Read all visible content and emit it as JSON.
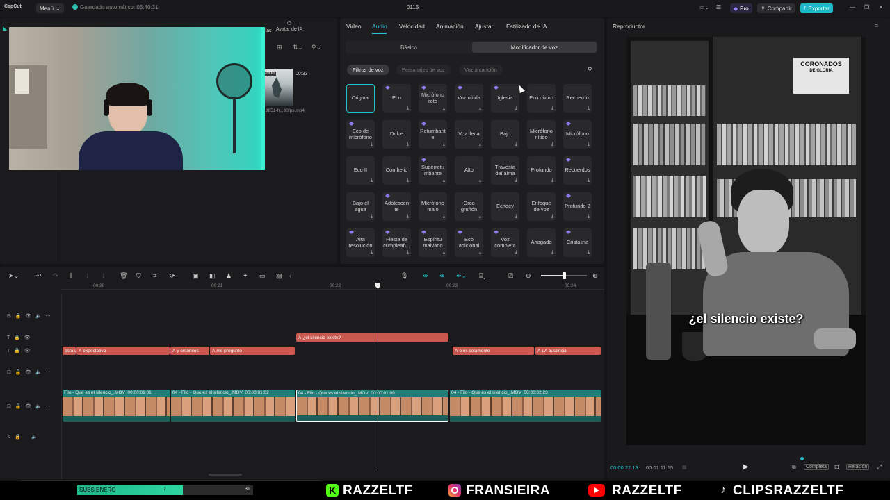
{
  "titlebar": {
    "app_name": "CapCut",
    "menu_label": "Menú",
    "autosave": "Guardado automático: 05:40:31",
    "project_name": "0115",
    "pro_label": "Pro",
    "share_label": "Compartir",
    "export_label": "Exportar"
  },
  "media": {
    "tabs": [
      "llas",
      "Avatar de IA"
    ],
    "clip_duration": "00:33",
    "clip_name": "8851-h...30fps.mp4",
    "added_badge": "adido"
  },
  "audio_panel": {
    "tabs": [
      "Video",
      "Audio",
      "Velocidad",
      "Animación",
      "Ajustar",
      "Estilizado de IA"
    ],
    "active_tab": "Audio",
    "subtabs": [
      "Básico",
      "Modificador de voz"
    ],
    "chips": [
      "Filtros de voz",
      "Personajes de voz",
      "Voz a canción"
    ],
    "effects": [
      "Original",
      "Eco",
      "Micrófono roto",
      "Voz nítida",
      "Iglesia",
      "Eco divino",
      "Recuerdo",
      "Eco de micrófono",
      "Dulce",
      "Retumbant e",
      "Voz llena",
      "Bajo",
      "Micrófono nítido",
      "Micrófono",
      "Eco II",
      "Con helio",
      "Superretu mbante",
      "Alto",
      "Travesía del alma",
      "Profundo",
      "Recuerdos",
      "Bajo el agua",
      "Adolescen te",
      "Micrófono malo",
      "Orco gruñón",
      "Echoey",
      "Enfoque de voz",
      "Profundo 2",
      "Alta resolución",
      "Fiesta de cumpleañ...",
      "Espíritu malvado",
      "Eco adicional",
      "Voz completa",
      "Ahogado",
      "Cristalina"
    ]
  },
  "player": {
    "title": "Reproductor",
    "caption": "¿el silencio existe?",
    "poster_title": "CORONADOS",
    "poster_sub": "DE GLORIA",
    "current_time": "00:00:22:13",
    "total_time": "00:01:11:15",
    "full_label": "Completa",
    "ratio_label": "Relación"
  },
  "timeline": {
    "ruler": [
      "00:20",
      "00:21",
      "00:22",
      "00:23",
      "00:24"
    ],
    "title_clip": "¿el silencio existe?",
    "text_clips": [
      "esta u",
      "expectativa",
      "y entonces",
      "me pregunto",
      "o es solamente",
      "LA ausencia"
    ],
    "video_clips": [
      {
        "name": "Filo - Que es el silencio_.MOV",
        "time": "00:00:01:01"
      },
      {
        "name": "04 - Filo - Que es el silencio_.MOV",
        "time": "00:00:01:02"
      },
      {
        "name": "04 - Filo - Que es el silencio_.MOV",
        "time": "00:00:01:09"
      },
      {
        "name": "04 - Filo - Que es el silencio_.MOV",
        "time": "00:00:02:23"
      }
    ]
  },
  "overlay": {
    "subs_label": "SUBS ENERO",
    "subs_mid": "7",
    "subs_goal": "31",
    "subs_progress": 0.6,
    "handles": [
      "RAZZELTF",
      "FRANSIEIRA",
      "RAZZELTF",
      "CLIPSRAZZELTF"
    ]
  },
  "colors": {
    "accent": "#22c3d1",
    "text_clip": "#c8594f",
    "video_clip": "#1f7e78",
    "kick": "#53fc18",
    "youtube": "#ff0000"
  }
}
